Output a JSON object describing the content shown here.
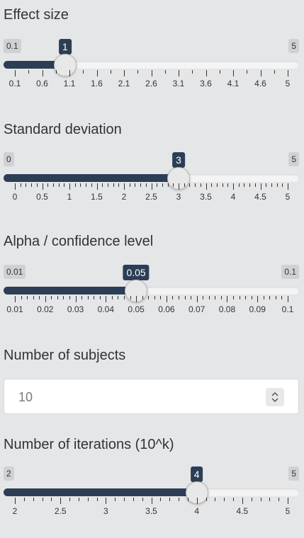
{
  "sliders": [
    {
      "id": "effect-size",
      "label": "Effect size",
      "min_label": "0.1",
      "max_label": "5",
      "value_label": "1",
      "value_fraction": 0.1837,
      "ticks": [
        "0.1",
        "0.6",
        "1.1",
        "1.6",
        "2.1",
        "2.6",
        "3.1",
        "3.6",
        "4.1",
        "4.6",
        "5"
      ],
      "minor_per_major": 1
    },
    {
      "id": "standard-deviation",
      "label": "Standard deviation",
      "min_label": "0",
      "max_label": "5",
      "value_label": "3",
      "value_fraction": 0.6,
      "ticks": [
        "0",
        "0.5",
        "1",
        "1.5",
        "2",
        "2.5",
        "3",
        "3.5",
        "4",
        "4.5",
        "5"
      ],
      "minor_per_major": 4
    },
    {
      "id": "alpha",
      "label": "Alpha / confidence level",
      "min_label": "0.01",
      "max_label": "0.1",
      "value_label": "0.05",
      "value_fraction": 0.4444,
      "ticks": [
        "0.01",
        "0.02",
        "0.03",
        "0.04",
        "0.05",
        "0.06",
        "0.07",
        "0.08",
        "0.09",
        "0.1"
      ],
      "minor_per_major": 4
    },
    {
      "id": "iterations",
      "label": "Number of iterations (10^k)",
      "min_label": "2",
      "max_label": "5",
      "value_label": "4",
      "value_fraction": 0.6667,
      "ticks": [
        "2",
        "2.5",
        "3",
        "3.5",
        "4",
        "4.5",
        "5"
      ],
      "minor_per_major": 4
    }
  ],
  "subjects": {
    "label": "Number of subjects",
    "value": "10"
  },
  "icons": {
    "spinner": "up-down-spinner-icon"
  },
  "colors": {
    "accent": "#2c3e55",
    "background": "#e5e6e8"
  }
}
